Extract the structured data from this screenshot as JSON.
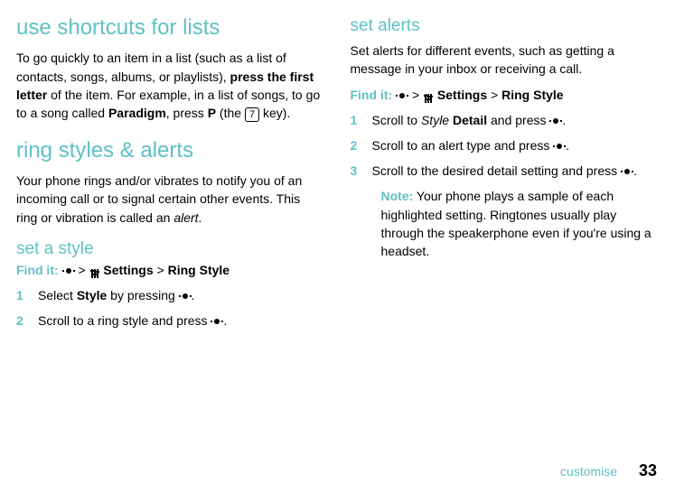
{
  "left": {
    "heading_shortcuts": "use shortcuts for lists",
    "shortcuts_p1_a": "To go quickly to an item in a list (such as a list of contacts, songs, albums, or playlists), ",
    "shortcuts_p1_b": "press the first letter",
    "shortcuts_p1_c": " of the item. For example, in a list of songs, to go to a song called ",
    "shortcuts_p1_d": "Paradigm",
    "shortcuts_p1_e": ", press ",
    "shortcuts_p1_f": "P",
    "shortcuts_p1_g": " (the ",
    "shortcuts_key": "7",
    "shortcuts_p1_h": " key).",
    "heading_ring": "ring styles & alerts",
    "ring_p1_a": "Your phone rings and/or vibrates to notify you of an incoming call or to signal certain other events. This ring or vibration is called an ",
    "ring_p1_b": "alert",
    "ring_p1_c": ".",
    "heading_setstyle": "set a style",
    "findit_label": "Find it:",
    "findit_gt": ">",
    "findit_settings": "Settings",
    "findit_ringstyle": "Ring Style",
    "step1_num": "1",
    "step1_a": "Select ",
    "step1_b": "Style",
    "step1_c": " by pressing ",
    "step1_d": ".",
    "step2_num": "2",
    "step2_a": "Scroll to a ring style and press ",
    "step2_d": "."
  },
  "right": {
    "heading_alerts": "set alerts",
    "alerts_p1": "Set alerts for different events, such as getting a message in your inbox or receiving a call.",
    "findit_label": "Find it:",
    "findit_gt": ">",
    "findit_settings": "Settings",
    "findit_ringstyle": "Ring Style",
    "step1_num": "1",
    "step1_a": "Scroll to ",
    "step1_b": "Style",
    "step1_c": " Detail",
    "step1_d": " and press ",
    "step1_e": ".",
    "step2_num": "2",
    "step2_a": "Scroll to an alert type and press ",
    "step2_e": ".",
    "step3_num": "3",
    "step3_a": "Scroll to the desired detail setting and press ",
    "step3_e": ".",
    "note_label": "Note:",
    "note_text": " Your phone plays a sample of each highlighted setting. Ringtones usually play through the speakerphone even if you're using a headset."
  },
  "footer": {
    "section": "customise",
    "page": "33"
  }
}
